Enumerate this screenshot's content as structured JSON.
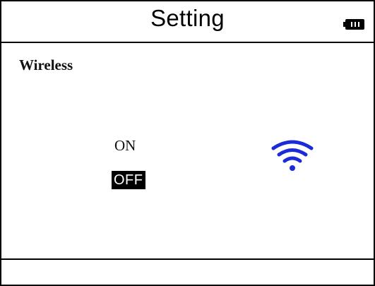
{
  "header": {
    "title": "Setting",
    "battery_icon": "battery-icon"
  },
  "content": {
    "section_label": "Wireless",
    "options": [
      {
        "label": "ON",
        "selected": false
      },
      {
        "label": "OFF",
        "selected": true
      }
    ],
    "status_icon": "wifi-icon",
    "status_icon_color": "#1c2bd8"
  },
  "colors": {
    "background": "#ffffff",
    "foreground": "#000000",
    "selection_bg": "#000000",
    "selection_text": "#ffffff"
  }
}
